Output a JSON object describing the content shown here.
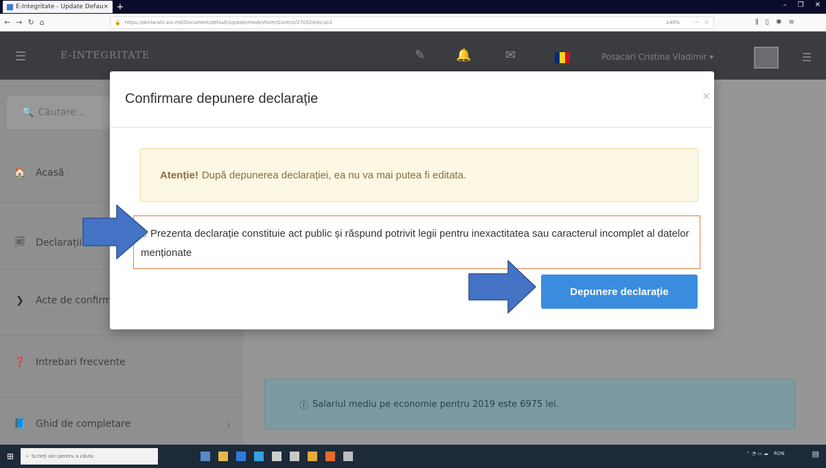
{
  "browser": {
    "tab_title": "E-Integritate - Update Default",
    "tab_close": "×",
    "new_tab": "+",
    "url": "https://declaratii.ani.md/Document/default/Update/model/form/Control/270324/local/1",
    "zoom": "140%",
    "window_controls": [
      "–",
      "❐",
      "✕"
    ]
  },
  "header": {
    "brand": "E-INTEGRITATE",
    "user_name": "Posacari Cristina Vladimir ▾",
    "flag_colors": [
      "#002b7f",
      "#fcd116",
      "#ce1126"
    ]
  },
  "sidebar": {
    "search_placeholder": "Căutare...",
    "items": [
      {
        "label": "Acasă",
        "icon": "home-icon",
        "glyph": "🏠"
      },
      {
        "label": "Declarații",
        "icon": "documents-icon",
        "glyph": "🗐"
      },
      {
        "label": "Acte de confirmare",
        "icon": "chevron-right-icon",
        "glyph": "❯"
      },
      {
        "label": "Intrebari frecvente",
        "icon": "question-circle-icon",
        "glyph": "❓"
      },
      {
        "label": "Ghid de completare",
        "icon": "book-icon",
        "glyph": "📘"
      }
    ]
  },
  "content": {
    "info_text": "Salariul mediu pe economie pentru 2019 este 6975 lei.",
    "info_icon": "info-circle-icon"
  },
  "modal": {
    "title": "Confirmare depunere declarație",
    "close_label": "×",
    "warning_bold": "Atenție!",
    "warning_text": "După depunerea declarației, ea nu va mai putea fi editata.",
    "consent_text": "Prezenta declarație constituie act public și răspund potrivit legii pentru inexactitatea sau caracterul incomplet al datelor menționate",
    "submit_label": "Depunere declarație"
  },
  "taskbar": {
    "search_placeholder": "Scrieți aici pentru a căuta",
    "tray_text": "RON"
  },
  "colors": {
    "accent": "#3a8dde",
    "arrow": "#4472c4",
    "consent_border": "#e17a3a"
  }
}
